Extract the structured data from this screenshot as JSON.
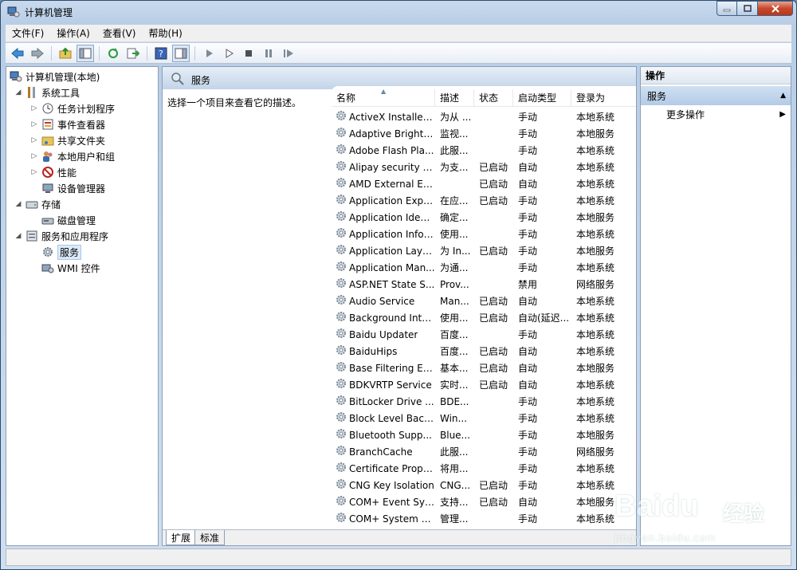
{
  "window": {
    "title": "计算机管理"
  },
  "menu": [
    {
      "label": "文件(F)"
    },
    {
      "label": "操作(A)"
    },
    {
      "label": "查看(V)"
    },
    {
      "label": "帮助(H)"
    }
  ],
  "toolbar": {
    "icons": [
      "back-arrow-icon",
      "forward-arrow-icon",
      "up-folder-icon",
      "show-hide-tree-icon",
      "refresh-icon",
      "export-list-icon",
      "help-icon",
      "properties-icon",
      "start-icon",
      "start-outline-icon",
      "stop-icon",
      "pause-icon",
      "restart-icon"
    ]
  },
  "tree": {
    "root": "计算机管理(本地)",
    "items": [
      {
        "label": "系统工具",
        "level": 1,
        "expander": "◢"
      },
      {
        "label": "任务计划程序",
        "level": 2,
        "expander": "▷"
      },
      {
        "label": "事件查看器",
        "level": 2,
        "expander": "▷"
      },
      {
        "label": "共享文件夹",
        "level": 2,
        "expander": "▷"
      },
      {
        "label": "本地用户和组",
        "level": 2,
        "expander": "▷"
      },
      {
        "label": "性能",
        "level": 2,
        "expander": "▷"
      },
      {
        "label": "设备管理器",
        "level": 2,
        "expander": ""
      },
      {
        "label": "存储",
        "level": 1,
        "expander": "◢"
      },
      {
        "label": "磁盘管理",
        "level": 2,
        "expander": ""
      },
      {
        "label": "服务和应用程序",
        "level": 1,
        "expander": "◢"
      },
      {
        "label": "服务",
        "level": 2,
        "expander": "",
        "selected": true
      },
      {
        "label": "WMI 控件",
        "level": 2,
        "expander": ""
      }
    ]
  },
  "center": {
    "header": "服务",
    "description": "选择一个项目来查看它的描述。",
    "columns": {
      "name": "名称",
      "desc": "描述",
      "status": "状态",
      "start": "启动类型",
      "logon": "登录为"
    },
    "rows": [
      {
        "name": "ActiveX Installer ...",
        "desc": "为从 ...",
        "status": "",
        "start": "手动",
        "logon": "本地系统"
      },
      {
        "name": "Adaptive Brightn...",
        "desc": "监视...",
        "status": "",
        "start": "手动",
        "logon": "本地服务"
      },
      {
        "name": "Adobe Flash Pla...",
        "desc": "此服...",
        "status": "",
        "start": "手动",
        "logon": "本地系统"
      },
      {
        "name": "Alipay security s...",
        "desc": "为支...",
        "status": "已启动",
        "start": "自动",
        "logon": "本地系统"
      },
      {
        "name": "AMD External Ev...",
        "desc": "",
        "status": "已启动",
        "start": "自动",
        "logon": "本地系统"
      },
      {
        "name": "Application Expe...",
        "desc": "在应...",
        "status": "已启动",
        "start": "手动",
        "logon": "本地系统"
      },
      {
        "name": "Application Iden...",
        "desc": "确定...",
        "status": "",
        "start": "手动",
        "logon": "本地服务"
      },
      {
        "name": "Application Infor...",
        "desc": "使用...",
        "status": "",
        "start": "手动",
        "logon": "本地系统"
      },
      {
        "name": "Application Laye...",
        "desc": "为 In...",
        "status": "已启动",
        "start": "手动",
        "logon": "本地服务"
      },
      {
        "name": "Application Man...",
        "desc": "为通...",
        "status": "",
        "start": "手动",
        "logon": "本地系统"
      },
      {
        "name": "ASP.NET State S...",
        "desc": "Prov...",
        "status": "",
        "start": "禁用",
        "logon": "网络服务"
      },
      {
        "name": "Audio Service",
        "desc": "Man...",
        "status": "已启动",
        "start": "自动",
        "logon": "本地系统"
      },
      {
        "name": "Background Inte...",
        "desc": "使用...",
        "status": "已启动",
        "start": "自动(延迟...",
        "logon": "本地系统"
      },
      {
        "name": "Baidu Updater",
        "desc": "百度...",
        "status": "",
        "start": "手动",
        "logon": "本地系统"
      },
      {
        "name": "BaiduHips",
        "desc": "百度...",
        "status": "已启动",
        "start": "自动",
        "logon": "本地系统"
      },
      {
        "name": "Base Filtering En...",
        "desc": "基本...",
        "status": "已启动",
        "start": "自动",
        "logon": "本地服务"
      },
      {
        "name": "BDKVRTP Service",
        "desc": "实时...",
        "status": "已启动",
        "start": "自动",
        "logon": "本地系统"
      },
      {
        "name": "BitLocker Drive ...",
        "desc": "BDE...",
        "status": "",
        "start": "手动",
        "logon": "本地系统"
      },
      {
        "name": "Block Level Back...",
        "desc": "Win...",
        "status": "",
        "start": "手动",
        "logon": "本地系统"
      },
      {
        "name": "Bluetooth Supp...",
        "desc": "Blue...",
        "status": "",
        "start": "手动",
        "logon": "本地服务"
      },
      {
        "name": "BranchCache",
        "desc": "此服...",
        "status": "",
        "start": "手动",
        "logon": "网络服务"
      },
      {
        "name": "Certificate Propa...",
        "desc": "将用...",
        "status": "",
        "start": "手动",
        "logon": "本地系统"
      },
      {
        "name": "CNG Key Isolation",
        "desc": "CNG...",
        "status": "已启动",
        "start": "手动",
        "logon": "本地系统"
      },
      {
        "name": "COM+ Event Sys...",
        "desc": "支持...",
        "status": "已启动",
        "start": "自动",
        "logon": "本地服务"
      },
      {
        "name": "COM+ System A...",
        "desc": "管理...",
        "status": "",
        "start": "手动",
        "logon": "本地系统"
      }
    ],
    "tabs": [
      {
        "label": "扩展"
      },
      {
        "label": "标准"
      }
    ]
  },
  "actions": {
    "header": "操作",
    "group": "服务",
    "item": "更多操作"
  },
  "watermark": {
    "brand": "Baidu",
    "cn": "经验",
    "url": "jingyan.baidu.com"
  }
}
